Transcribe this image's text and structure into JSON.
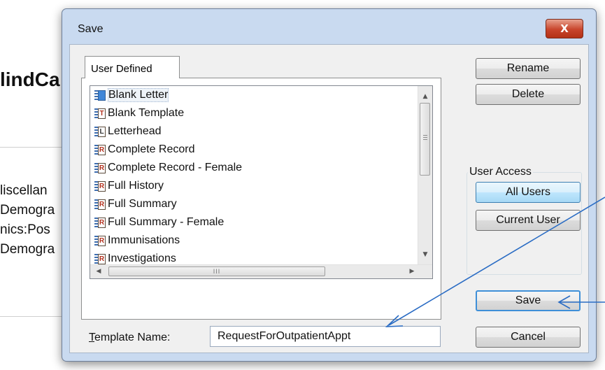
{
  "background": {
    "title": "lindCa",
    "items": [
      "liscellan",
      "Demogra",
      "nics:Pos",
      "Demogra"
    ]
  },
  "dialog": {
    "title": "Save",
    "close_label": "X",
    "tab_label": "User Defined",
    "list": [
      {
        "label": "Blank Letter",
        "icon": "letter-doc-icon",
        "glyph": ""
      },
      {
        "label": "Blank Template",
        "icon": "template-doc-icon",
        "glyph": "T"
      },
      {
        "label": "Letterhead",
        "icon": "letterhead-doc-icon",
        "glyph": "L"
      },
      {
        "label": "Complete Record",
        "icon": "record-doc-icon",
        "glyph": "R"
      },
      {
        "label": "Complete Record - Female",
        "icon": "record-doc-icon",
        "glyph": "R"
      },
      {
        "label": "Full History",
        "icon": "record-doc-icon",
        "glyph": "R"
      },
      {
        "label": "Full Summary",
        "icon": "record-doc-icon",
        "glyph": "R"
      },
      {
        "label": "Full Summary - Female",
        "icon": "record-doc-icon",
        "glyph": "R"
      },
      {
        "label": "Immunisations",
        "icon": "record-doc-icon",
        "glyph": "R"
      },
      {
        "label": "Investigations",
        "icon": "record-doc-icon",
        "glyph": "R"
      }
    ],
    "template_name_label_first": "T",
    "template_name_label_rest": "emplate Name:",
    "template_name_value": "RequestForOutpatientAppt",
    "buttons": {
      "rename": "Rename",
      "delete": "Delete",
      "all_users": "All Users",
      "current_user": "Current User",
      "save": "Save",
      "cancel": "Cancel"
    },
    "user_access_label": "User Access",
    "hscroll_grip": "III",
    "colors": {
      "annotation_arrow": "#2a6cc4",
      "selected_button": "#bee6fd"
    }
  }
}
